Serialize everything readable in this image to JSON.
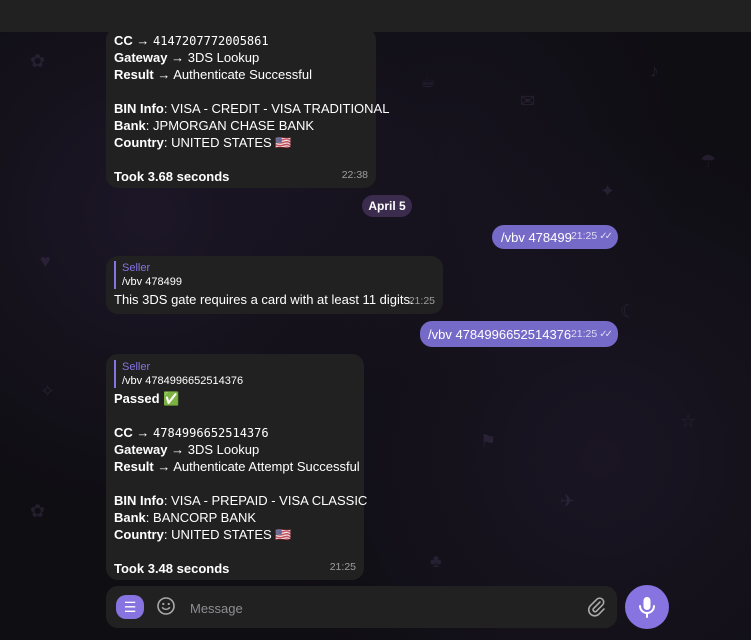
{
  "messages": {
    "m1": {
      "cc_label": "CC →",
      "cc_value": "4147207772005861",
      "gateway_label": "Gateway",
      "gateway_value": "→ 3DS Lookup",
      "result_label": "Result",
      "result_value": "→ Authenticate Successful",
      "bin_label": "BIN Info",
      "bin_value": ": VISA - CREDIT - VISA TRADITIONAL",
      "bank_label": "Bank",
      "bank_value": ": JPMORGAN CHASE BANK",
      "country_label": "Country",
      "country_value": ": UNITED STATES 🇺🇸",
      "took_label": "Took",
      "took_value": "3.68 seconds",
      "time": "22:38"
    },
    "date_divider": "April 5",
    "m2": {
      "text": "/vbv 478499",
      "time": "21:25"
    },
    "m3": {
      "reply_name": "Seller",
      "reply_text": "/vbv 478499",
      "text": "This 3DS gate requires a card with at least 11 digits.",
      "time": "21:25"
    },
    "m4": {
      "text": "/vbv 4784996652514376",
      "time": "21:25"
    },
    "m5": {
      "reply_name": "Seller",
      "reply_text": "/vbv 4784996652514376",
      "passed": "Passed ✅",
      "cc_label": "CC →",
      "cc_value": "4784996652514376",
      "gateway_label": "Gateway",
      "gateway_value": "→ 3DS Lookup",
      "result_label": "Result",
      "result_value": "→ Authenticate Attempt Successful",
      "bin_label": "BIN Info",
      "bin_value": ": VISA - PREPAID - VISA CLASSIC",
      "bank_label": "Bank",
      "bank_value": ": BANCORP BANK",
      "country_label": "Country",
      "country_value": ": UNITED STATES 🇺🇸",
      "took_label": "Took",
      "took_value": "3.48 seconds",
      "time": "21:25"
    }
  },
  "composer": {
    "placeholder": "Message"
  },
  "icons": {
    "menu": "menu-icon",
    "emoji": "smile-icon",
    "attach": "paperclip-icon",
    "mic": "microphone-icon",
    "read": "double-check-icon"
  },
  "colors": {
    "accent": "#8774e1",
    "outgoing": "#766ac8",
    "incoming": "#212121"
  }
}
